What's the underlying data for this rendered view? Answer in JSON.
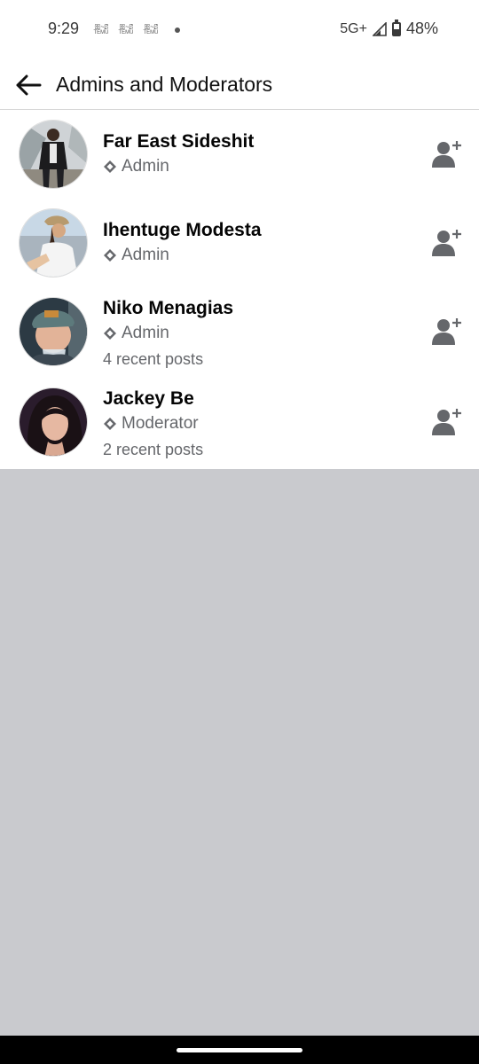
{
  "status_bar": {
    "time": "9:29",
    "notifications": [
      {
        "glyph": "ꕥ~ꗟ",
        "label": "TEMU"
      },
      {
        "glyph": "ꕥ~ꗟ",
        "label": "TEMU"
      },
      {
        "glyph": "ꕥ~ꗟ",
        "label": "TEMU"
      }
    ],
    "network": "5G+",
    "battery_percent": "48%",
    "battery_level": 0.48
  },
  "header": {
    "title": "Admins and Moderators"
  },
  "members": [
    {
      "name": "Far East Sideshit",
      "role": "Admin",
      "recent_posts": ""
    },
    {
      "name": "Ihentuge Modesta",
      "role": "Admin",
      "recent_posts": ""
    },
    {
      "name": "Niko Menagias",
      "role": "Admin",
      "recent_posts": "4 recent posts"
    },
    {
      "name": "Jackey Be",
      "role": "Moderator",
      "recent_posts": "2 recent posts"
    }
  ],
  "colors": {
    "background_empty": "#c9cace",
    "secondary_text": "#65676b",
    "icon": "#65676b"
  }
}
